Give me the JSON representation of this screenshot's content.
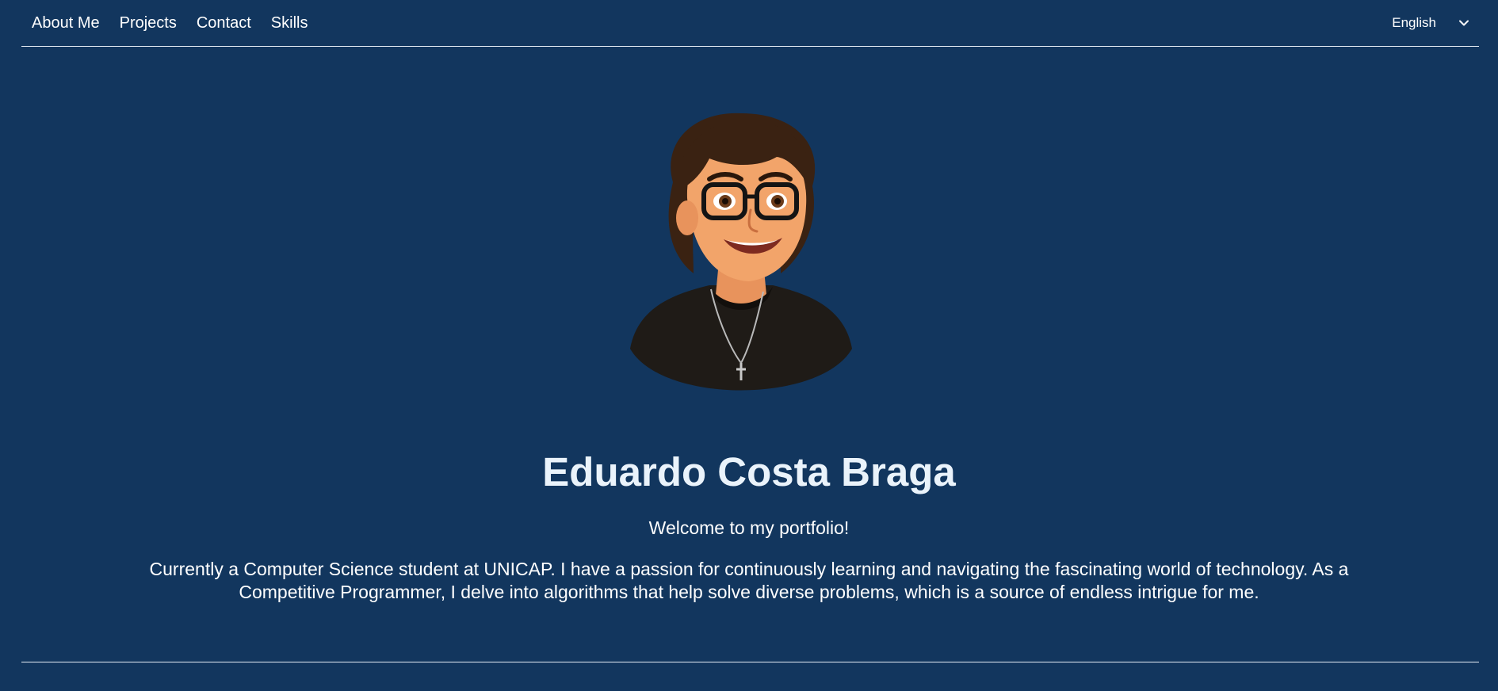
{
  "nav": {
    "links": [
      {
        "label": "About Me"
      },
      {
        "label": "Projects"
      },
      {
        "label": "Contact"
      },
      {
        "label": "Skills"
      }
    ],
    "language": {
      "selected": "English"
    }
  },
  "hero": {
    "name": "Eduardo Costa Braga",
    "welcome": "Welcome to my portfolio!",
    "bio": "Currently a Computer Science student at UNICAP. I have a passion for continuously learning and navigating the fascinating world of technology. As a Competitive Programmer, I delve into algorithms that help solve diverse problems, which is a source of endless intrigue for me."
  },
  "colors": {
    "background": "#12365e",
    "divider": "#e6edf5",
    "heading": "#eaf3fb",
    "text": "#ffffff"
  },
  "icons": {
    "language_dropdown": "chevron-down-icon",
    "avatar": "cartoon-portrait"
  }
}
